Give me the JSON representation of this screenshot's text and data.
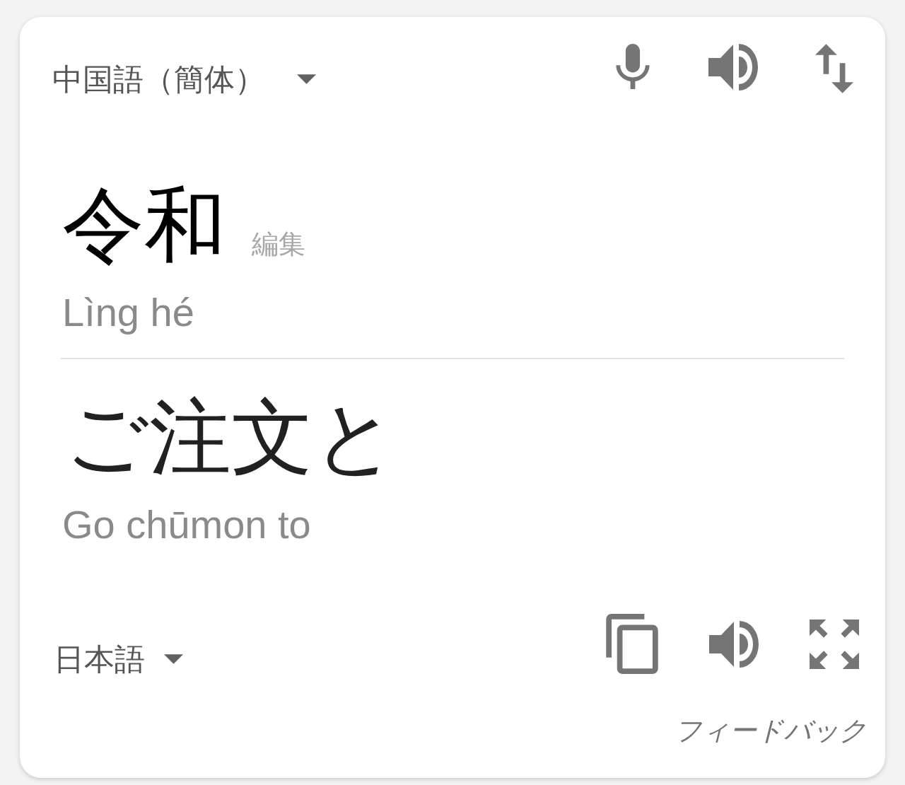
{
  "source": {
    "language": "中国語（簡体）",
    "text": "令和",
    "edit_label": "編集",
    "romanization": "Lìng hé"
  },
  "target": {
    "language": "日本語",
    "text": "ご注文と",
    "romanization": "Go chūmon to"
  },
  "feedback": "フィードバック"
}
